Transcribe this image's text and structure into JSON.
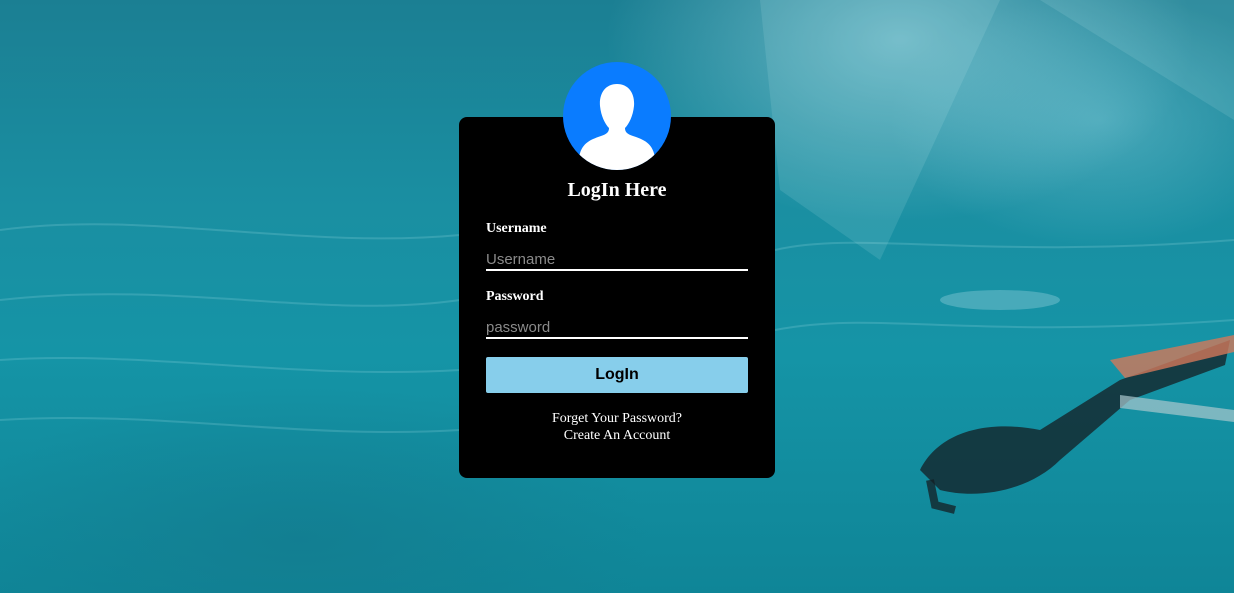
{
  "login": {
    "title": "LogIn Here",
    "username_label": "Username",
    "username_placeholder": "Username",
    "password_label": "Password",
    "password_placeholder": "password",
    "login_button": "LogIn",
    "forgot_link": "Forget Your Password?",
    "create_link": "Create An Account"
  },
  "colors": {
    "card": "#000000",
    "avatar": "#0a7cff",
    "button": "#87ceeb"
  },
  "icons": {
    "avatar": "user-silhouette-icon"
  }
}
